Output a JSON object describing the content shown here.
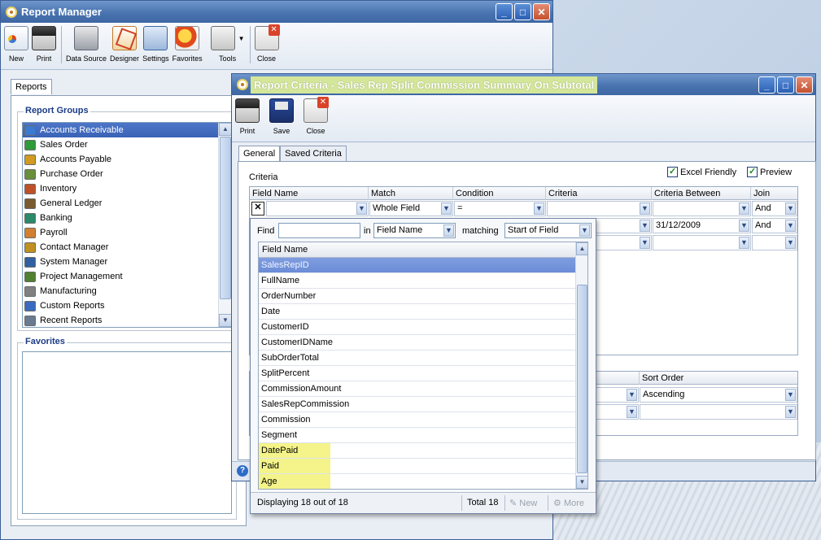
{
  "report_manager": {
    "title": "Report Manager",
    "toolbar": [
      {
        "label": "New",
        "icon": "new-report-icon"
      },
      {
        "label": "Print",
        "icon": "printer-icon"
      },
      {
        "label": "Data Source",
        "icon": "database-icon"
      },
      {
        "label": "Designer",
        "icon": "designer-icon"
      },
      {
        "label": "Settings",
        "icon": "settings-icon"
      },
      {
        "label": "Favorites",
        "icon": "favorites-icon"
      },
      {
        "label": "Tools",
        "icon": "tools-icon"
      },
      {
        "label": "Close",
        "icon": "close-doc-icon"
      }
    ],
    "tab": "Reports",
    "report_groups_heading": "Report Groups",
    "report_groups": [
      "Accounts Receivable",
      "Sales Order",
      "Accounts Payable",
      "Purchase Order",
      "Inventory",
      "General Ledger",
      "Banking",
      "Payroll",
      "Contact Manager",
      "System Manager",
      "Project Management",
      "Manufacturing",
      "Custom Reports",
      "Recent Reports"
    ],
    "selected_group": "Accounts Receivable",
    "favorites_heading": "Favorites"
  },
  "report_criteria": {
    "title": "Report Criteria - Sales Rep Split Commission Summary On Subtotal",
    "toolbar": [
      {
        "label": "Print",
        "icon": "printer-icon"
      },
      {
        "label": "Save",
        "icon": "save-icon"
      },
      {
        "label": "Close",
        "icon": "close-doc-icon"
      }
    ],
    "tabs": [
      "General",
      "Saved Criteria"
    ],
    "criteria_label": "Criteria",
    "excel_friendly": "Excel Friendly",
    "preview": "Preview",
    "columns": [
      "Field Name",
      "Match",
      "Condition",
      "Criteria",
      "Criteria Between",
      "Join"
    ],
    "row1": {
      "match": "Whole Field",
      "condition": "=",
      "join": "And"
    },
    "row2": {
      "criteria_between": "31/12/2009",
      "join": "And"
    },
    "sort_order_header": "Sort Order",
    "sort_order_value": "Ascending"
  },
  "field_picker": {
    "find_label": "Find",
    "find_value": "",
    "in_label": "in",
    "in_value": "Field Name",
    "matching_label": "matching",
    "matching_value": "Start of Field",
    "column_header": "Field Name",
    "fields": [
      "SalesRepID",
      "FullName",
      "OrderNumber",
      "Date",
      "CustomerID",
      "CustomerIDName",
      "SubOrderTotal",
      "SplitPercent",
      "CommissionAmount",
      "SalesRepCommission",
      "Commission",
      "Segment",
      "DatePaid",
      "Paid",
      "Age"
    ],
    "selected_field": "SalesRepID",
    "highlighted_fields": [
      "DatePaid",
      "Paid",
      "Age"
    ],
    "status": "Displaying 18 out of 18",
    "total": "Total 18",
    "new_label": "New",
    "more_label": "More"
  }
}
